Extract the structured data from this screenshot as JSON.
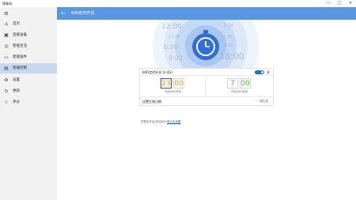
{
  "window": {
    "title": "格鲁纳",
    "controls": {
      "minimize": "—",
      "maximize": "□",
      "close": "✕"
    }
  },
  "sidebar": {
    "menu_icon": "hamburger-icon",
    "items": [
      {
        "label": "首页",
        "icon": "home-icon"
      },
      {
        "label": "连接设备",
        "icon": "devices-icon"
      },
      {
        "label": "智能生活",
        "icon": "bulb-icon"
      },
      {
        "label": "智能插件",
        "icon": "plugin-icon"
      },
      {
        "label": "智能控制",
        "icon": "control-icon",
        "active": true
      },
      {
        "label": "设置",
        "icon": "gear-icon"
      },
      {
        "label": "更新",
        "icon": "refresh-icon"
      },
      {
        "label": "评分",
        "icon": "star-icon"
      }
    ]
  },
  "header": {
    "back_icon": "back-arrow-icon",
    "title": "Wifi定时开关",
    "color": "#5a97e2"
  },
  "clock_decoration": {
    "ghost_times": [
      "12:00",
      "7:30",
      "13:45",
      "6:00",
      "12:30",
      "5:30",
      "9:00",
      "18:00"
    ],
    "icon": "stopwatch-icon"
  },
  "wifi_timer": {
    "title": "WiFi定时开关 (2.4G)",
    "toggle_state": "开",
    "off_time": {
      "hour": "23",
      "minute": "00",
      "caption": "关闭WiFi时间"
    },
    "on_time": {
      "hour": "7",
      "minute": "00",
      "caption": "开启WiFi时间"
    },
    "repeat_label": "设置生效日期",
    "repeat_value": "一直生效",
    "colors": {
      "off_hour": "#f0a018",
      "off_minute": "#f0a018",
      "on_digits": "#5cbf3a",
      "toggle": "#1f6fd6"
    }
  },
  "footer": {
    "note_prefix": "您暂定开启/关闭WiFi",
    "note_link": "请点击设置"
  }
}
